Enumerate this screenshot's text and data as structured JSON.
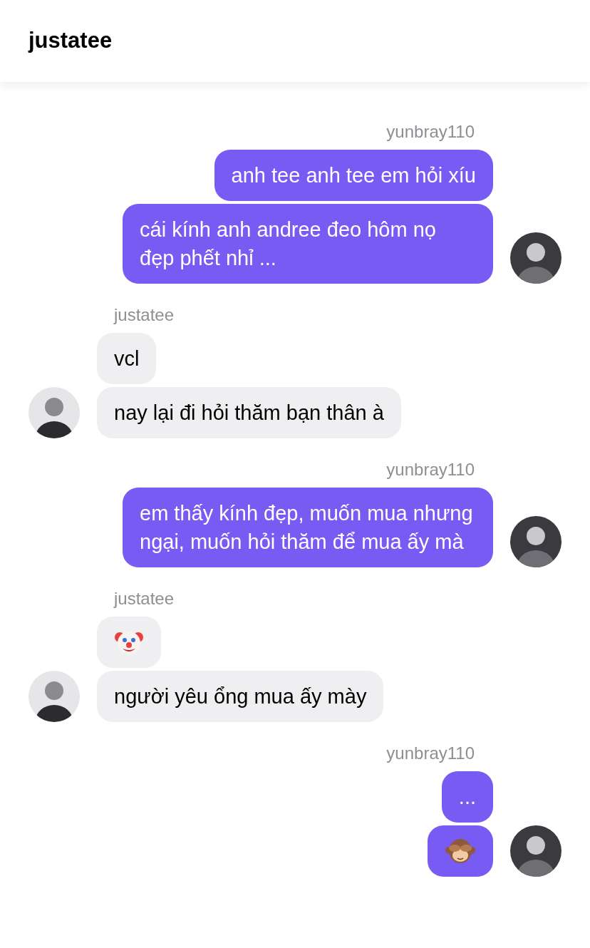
{
  "header": {
    "title": "justatee"
  },
  "groups": [
    {
      "sender": "yunbray110",
      "outgoing": true,
      "messages": [
        {
          "kind": "text",
          "text": "anh tee anh tee em hỏi xíu"
        },
        {
          "kind": "text",
          "text": "cái kính anh andree đeo hôm nọ đẹp phết nhỉ ..."
        }
      ]
    },
    {
      "sender": "justatee",
      "outgoing": false,
      "messages": [
        {
          "kind": "text",
          "text": "vcl"
        },
        {
          "kind": "text",
          "text": "nay lại đi hỏi thăm bạn thân à"
        }
      ]
    },
    {
      "sender": "yunbray110",
      "outgoing": true,
      "messages": [
        {
          "kind": "text",
          "text": "em thấy kính đẹp, muốn mua nhưng ngại, muốn hỏi thăm để mua ấy mà"
        }
      ]
    },
    {
      "sender": "justatee",
      "outgoing": false,
      "messages": [
        {
          "kind": "clown"
        },
        {
          "kind": "text",
          "text": "người yêu ổng mua ấy mày"
        }
      ]
    },
    {
      "sender": "yunbray110",
      "outgoing": true,
      "messages": [
        {
          "kind": "text",
          "text": "..."
        },
        {
          "kind": "monkey"
        }
      ]
    }
  ]
}
